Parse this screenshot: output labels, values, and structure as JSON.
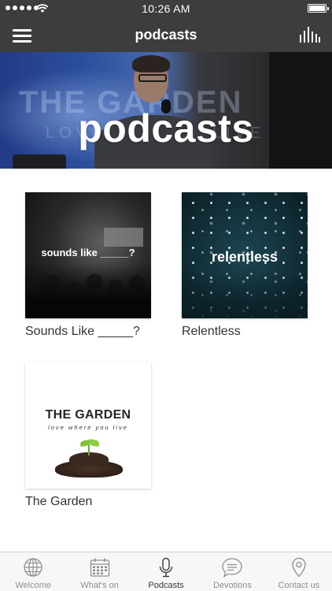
{
  "status_bar": {
    "time": "10:26 AM",
    "signal_dots": 5,
    "wifi_icon": "wifi-icon",
    "battery_level": 1.0
  },
  "nav": {
    "title": "podcasts",
    "menu_icon": "hamburger-menu-icon",
    "right_icon": "audio-levels-icon"
  },
  "hero": {
    "title": "podcasts",
    "background_text_1": "THE GARDEN",
    "background_text_2": "LOVE W",
    "background_text_3": "LIVE"
  },
  "podcasts": [
    {
      "title": "Sounds Like _____?",
      "art_text": "sounds like _____?"
    },
    {
      "title": "Relentless",
      "art_text": "relentless"
    },
    {
      "title": "The Garden",
      "art_text": "THE GARDEN",
      "art_subtext": "love where you live"
    }
  ],
  "tab_bar": {
    "items": [
      {
        "label": "Welcome",
        "icon": "globe-icon",
        "active": false
      },
      {
        "label": "What's on",
        "icon": "calendar-icon",
        "active": false
      },
      {
        "label": "Podcasts",
        "icon": "microphone-icon",
        "active": true
      },
      {
        "label": "Devotions",
        "icon": "speech-bubble-icon",
        "active": false
      },
      {
        "label": "Contact us",
        "icon": "location-pin-icon",
        "active": false
      }
    ]
  },
  "colors": {
    "nav_background": "#3d3d3d",
    "tab_active": "#3a3a3a",
    "tab_inactive": "#8e8e8e",
    "page_background": "#ffffff"
  }
}
